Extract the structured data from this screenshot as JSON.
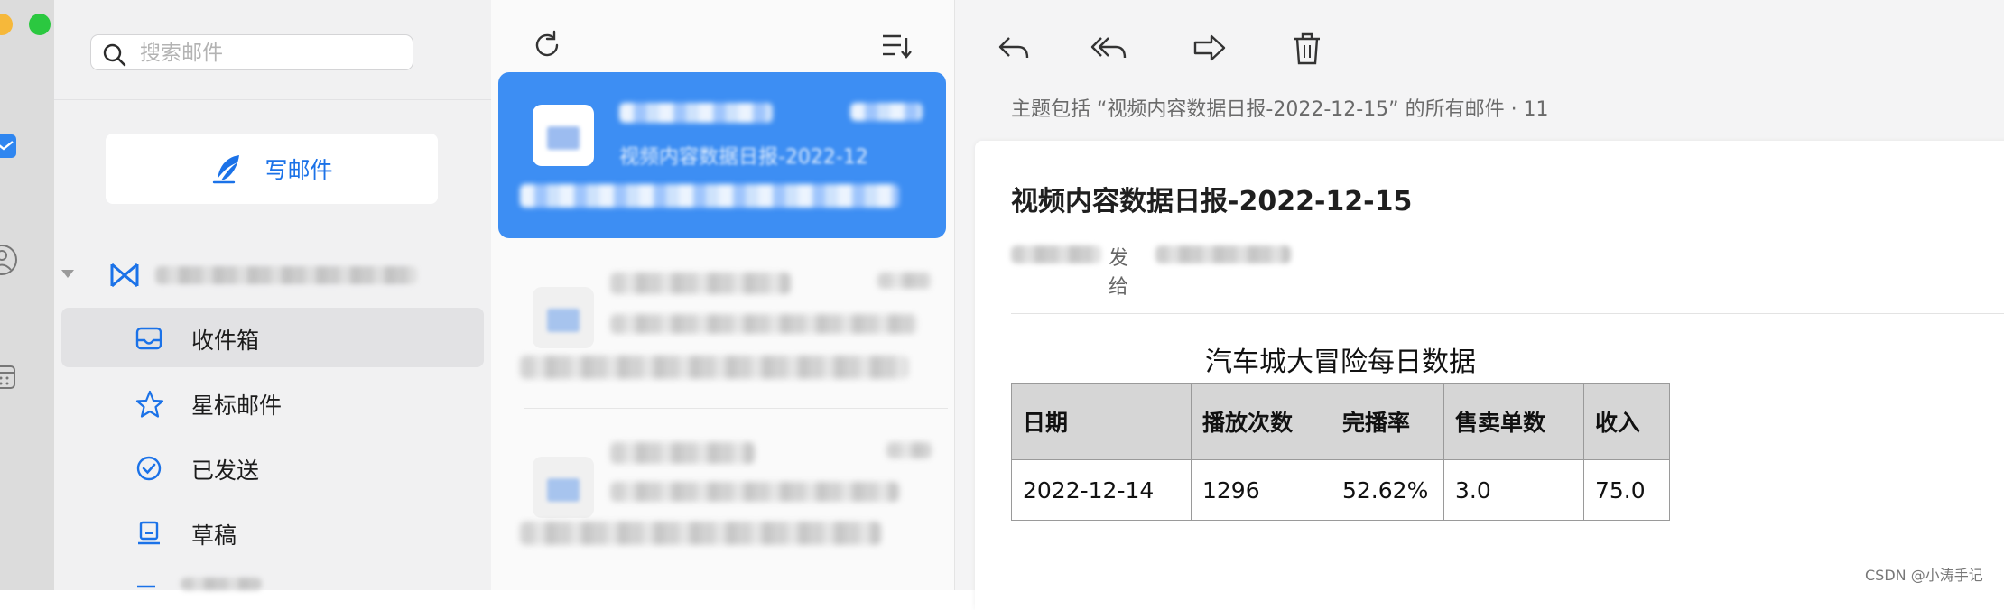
{
  "search": {
    "placeholder": "搜索邮件"
  },
  "compose": {
    "label": "写邮件"
  },
  "nav": [
    {
      "label": "收件箱",
      "icon": "inbox-icon",
      "active": true
    },
    {
      "label": "星标邮件",
      "icon": "star-icon",
      "active": false
    },
    {
      "label": "已发送",
      "icon": "check-circle-icon",
      "active": false
    },
    {
      "label": "草稿",
      "icon": "draft-icon",
      "active": false
    }
  ],
  "list": {
    "selected_subject": "视频内容数据日报-2022-12"
  },
  "reader": {
    "thread_info": "主题包括 “视频内容数据日报-2022-12-15” 的所有邮件 · 11",
    "title": "视频内容数据日报-2022-12-15",
    "sent_to": "发给",
    "table_title": "汽车城大冒险每日数据",
    "table": {
      "headers": [
        "日期",
        "播放次数",
        "完播率",
        "售卖单数",
        "收入"
      ],
      "rows": [
        [
          "2022-12-14",
          "1296",
          "52.62%",
          "3.0",
          "75.0"
        ]
      ]
    }
  },
  "watermark": "CSDN @小涛手记",
  "colors": {
    "accent": "#1b72e8",
    "selected": "#3d8ef3"
  }
}
